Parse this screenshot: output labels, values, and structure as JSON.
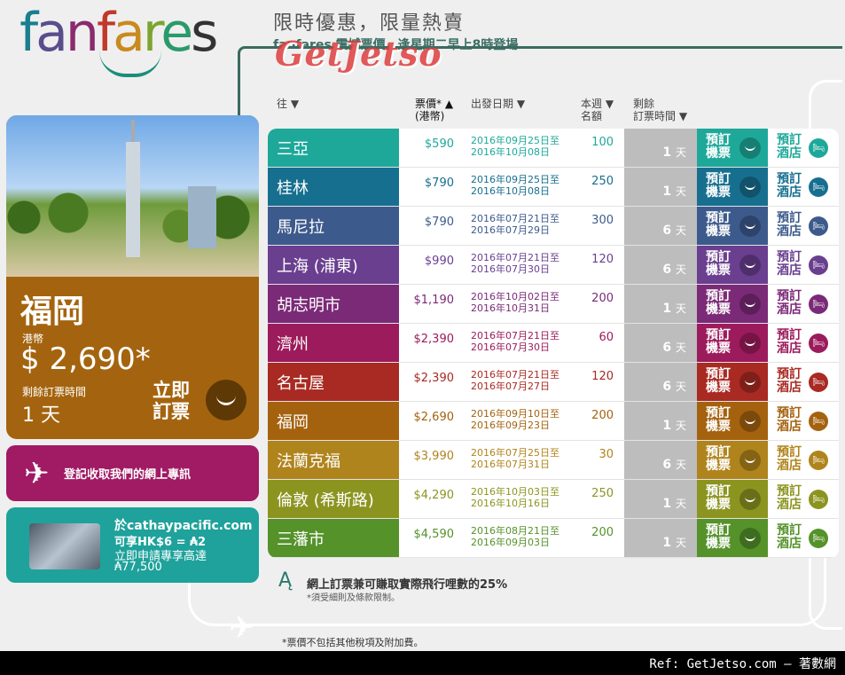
{
  "logo": "fanfares",
  "headline": "限時優惠，限量熱賣",
  "subline": "fanfares 震撼票價，逢星期二早上8時登場......",
  "watermark": "GetJetso",
  "promo": {
    "city": "福岡",
    "currency": "港幣",
    "price": "$ 2,690*",
    "remain_label": "剩餘訂票時間",
    "remain": "1 天",
    "book": "立即 訂票"
  },
  "newsletter": {
    "label": "登記收取我們的網上專訊"
  },
  "card": {
    "line1": "於cathaypacific.com",
    "line2": "可享HK$6 = ₳2",
    "line3": "立即申請專享高達",
    "line4": "₳77,500"
  },
  "table_headers": {
    "to": "往 ▼",
    "price": "票價* ▲",
    "price_unit": "(港幣)",
    "date": "出發日期 ▼",
    "seats1": "本週",
    "seats2": "名額",
    "remain1": "剩餘",
    "remain2": "訂票時間"
  },
  "rows": [
    {
      "city": "三亞",
      "price": "$590",
      "date1": "2016年09月25日至",
      "date2": "2016年10月08日",
      "seats": "100",
      "days": "1",
      "color": "#1ea89a",
      "text": "#1ea89a"
    },
    {
      "city": "桂林",
      "price": "$790",
      "date1": "2016年09月25日至",
      "date2": "2016年10月08日",
      "seats": "250",
      "days": "1",
      "color": "#176f8f",
      "text": "#176f8f"
    },
    {
      "city": "馬尼拉",
      "price": "$790",
      "date1": "2016年07月21日至",
      "date2": "2016年07月29日",
      "seats": "300",
      "days": "6",
      "color": "#3d5a8c",
      "text": "#3d5a8c"
    },
    {
      "city": "上海 (浦東)",
      "price": "$990",
      "date1": "2016年07月21日至",
      "date2": "2016年07月30日",
      "seats": "120",
      "days": "6",
      "color": "#6a3f8f",
      "text": "#6a3f8f"
    },
    {
      "city": "胡志明市",
      "price": "$1,190",
      "date1": "2016年10月02日至",
      "date2": "2016年10月31日",
      "seats": "200",
      "days": "1",
      "color": "#7b2a77",
      "text": "#7b2a77"
    },
    {
      "city": "濟州",
      "price": "$2,390",
      "date1": "2016年07月21日至",
      "date2": "2016年07月30日",
      "seats": "60",
      "days": "6",
      "color": "#9c1b5c",
      "text": "#9c1b5c"
    },
    {
      "city": "名古屋",
      "price": "$2,390",
      "date1": "2016年07月21日至",
      "date2": "2016年07月27日",
      "seats": "120",
      "days": "6",
      "color": "#a82a22",
      "text": "#a82a22"
    },
    {
      "city": "福岡",
      "price": "$2,690",
      "date1": "2016年09月10日至",
      "date2": "2016年09月23日",
      "seats": "200",
      "days": "1",
      "color": "#a4620f",
      "text": "#a4620f"
    },
    {
      "city": "法蘭克福",
      "price": "$3,990",
      "date1": "2016年07月25日至",
      "date2": "2016年07月31日",
      "seats": "30",
      "days": "6",
      "color": "#b0841c",
      "text": "#b0841c"
    },
    {
      "city": "倫敦 (希斯路)",
      "price": "$4,290",
      "date1": "2016年10月03日至",
      "date2": "2016年10月16日",
      "seats": "250",
      "days": "1",
      "color": "#8c9420",
      "text": "#8c9420"
    },
    {
      "city": "三藩市",
      "price": "$4,590",
      "date1": "2016年08月21日至",
      "date2": "2016年09月03日",
      "seats": "200",
      "days": "1",
      "color": "#55922a",
      "text": "#55922a"
    }
  ],
  "row_labels": {
    "days_unit": "天",
    "book_flight": "預訂 機票",
    "book_hotel": "預訂 酒店"
  },
  "miles": {
    "text": "網上訂票兼可賺取實際飛行哩數的25%",
    "note": "*須受細則及條款限制。"
  },
  "disclaimer": "*票價不包括其他稅項及附加費。",
  "footer": "Ref: GetJetso.com – 著數網"
}
